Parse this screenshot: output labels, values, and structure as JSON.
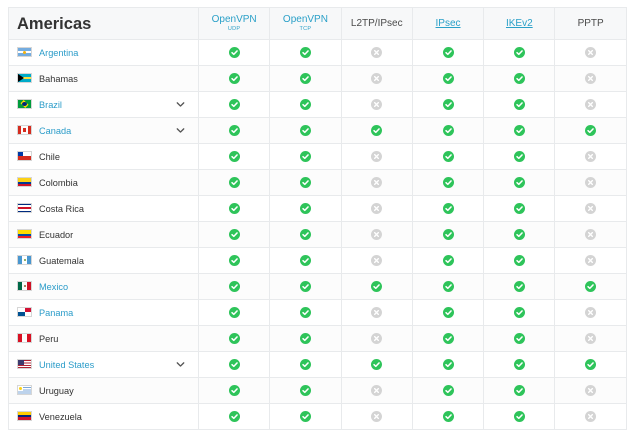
{
  "region_title": "Americas",
  "protocols": [
    {
      "name": "OpenVPN",
      "sub": "UDP",
      "style": "link"
    },
    {
      "name": "OpenVPN",
      "sub": "TCP",
      "style": "link"
    },
    {
      "name": "L2TP/IPsec",
      "sub": "",
      "style": "plain"
    },
    {
      "name": "IPsec",
      "sub": "",
      "style": "underline"
    },
    {
      "name": "IKEv2",
      "sub": "",
      "style": "underline"
    },
    {
      "name": "PPTP",
      "sub": "",
      "style": "plain"
    }
  ],
  "status_colors": {
    "supported": "#2ec45a",
    "unsupported": "#d4d4d4"
  },
  "countries": [
    {
      "name": "Argentina",
      "flag": "argentina-flag-icon",
      "link": true,
      "expand": false,
      "support": [
        true,
        true,
        false,
        true,
        true,
        false
      ]
    },
    {
      "name": "Bahamas",
      "flag": "bahamas-flag-icon",
      "link": false,
      "expand": false,
      "support": [
        true,
        true,
        false,
        true,
        true,
        false
      ]
    },
    {
      "name": "Brazil",
      "flag": "brazil-flag-icon",
      "link": true,
      "expand": true,
      "support": [
        true,
        true,
        false,
        true,
        true,
        false
      ]
    },
    {
      "name": "Canada",
      "flag": "canada-flag-icon",
      "link": true,
      "expand": true,
      "support": [
        true,
        true,
        true,
        true,
        true,
        true
      ]
    },
    {
      "name": "Chile",
      "flag": "chile-flag-icon",
      "link": false,
      "expand": false,
      "support": [
        true,
        true,
        false,
        true,
        true,
        false
      ]
    },
    {
      "name": "Colombia",
      "flag": "colombia-flag-icon",
      "link": false,
      "expand": false,
      "support": [
        true,
        true,
        false,
        true,
        true,
        false
      ]
    },
    {
      "name": "Costa Rica",
      "flag": "costa-rica-flag-icon",
      "link": false,
      "expand": false,
      "support": [
        true,
        true,
        false,
        true,
        true,
        false
      ]
    },
    {
      "name": "Ecuador",
      "flag": "ecuador-flag-icon",
      "link": false,
      "expand": false,
      "support": [
        true,
        true,
        false,
        true,
        true,
        false
      ]
    },
    {
      "name": "Guatemala",
      "flag": "guatemala-flag-icon",
      "link": false,
      "expand": false,
      "support": [
        true,
        true,
        false,
        true,
        true,
        false
      ]
    },
    {
      "name": "Mexico",
      "flag": "mexico-flag-icon",
      "link": true,
      "expand": false,
      "support": [
        true,
        true,
        true,
        true,
        true,
        true
      ]
    },
    {
      "name": "Panama",
      "flag": "panama-flag-icon",
      "link": true,
      "expand": false,
      "support": [
        true,
        true,
        false,
        true,
        true,
        false
      ]
    },
    {
      "name": "Peru",
      "flag": "peru-flag-icon",
      "link": false,
      "expand": false,
      "support": [
        true,
        true,
        false,
        true,
        true,
        false
      ]
    },
    {
      "name": "United States",
      "flag": "united-states-flag-icon",
      "link": true,
      "expand": true,
      "support": [
        true,
        true,
        true,
        true,
        true,
        true
      ]
    },
    {
      "name": "Uruguay",
      "flag": "uruguay-flag-icon",
      "link": false,
      "expand": false,
      "support": [
        true,
        true,
        false,
        true,
        true,
        false
      ]
    },
    {
      "name": "Venezuela",
      "flag": "venezuela-flag-icon",
      "link": false,
      "expand": false,
      "support": [
        true,
        true,
        false,
        true,
        true,
        false
      ]
    }
  ]
}
